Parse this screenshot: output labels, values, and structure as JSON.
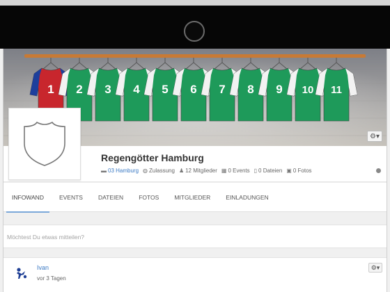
{
  "group": {
    "title": "Regengötter Hamburg",
    "meta": {
      "location": "03 Hamburg",
      "access": "Zulassung",
      "members": "12 Mitglieder",
      "events": "0 Events",
      "files": "0 Dateien",
      "photos": "0 Fotos"
    }
  },
  "cover": {
    "jersey_numbers": [
      "1",
      "2",
      "3",
      "4",
      "5",
      "6",
      "7",
      "8",
      "9",
      "10",
      "11"
    ],
    "colors": {
      "keeper_red": "#c8262d",
      "keeper_blue": "#1d3f9c",
      "field_green": "#1e9a5a",
      "field_white": "#f2f2f2"
    }
  },
  "tabs": [
    {
      "label": "INFOWAND",
      "active": true
    },
    {
      "label": "EVENTS",
      "active": false
    },
    {
      "label": "DATEIEN",
      "active": false
    },
    {
      "label": "FOTOS",
      "active": false
    },
    {
      "label": "MITGLIEDER",
      "active": false
    },
    {
      "label": "EINLADUNGEN",
      "active": false
    }
  ],
  "composer": {
    "placeholder": "Möchtest Du etwas mitteilen?"
  },
  "feed": [
    {
      "author": "Ivan",
      "time": "vor 3 Tagen"
    }
  ],
  "icons": {
    "cover_menu": "gear-icon",
    "post_menu": "gear-icon",
    "location": "folder-icon",
    "access": "globe-icon",
    "members": "users-icon",
    "events": "calendar-icon",
    "files": "file-icon",
    "photos": "image-icon"
  },
  "accent_color": "#3b7ac4"
}
